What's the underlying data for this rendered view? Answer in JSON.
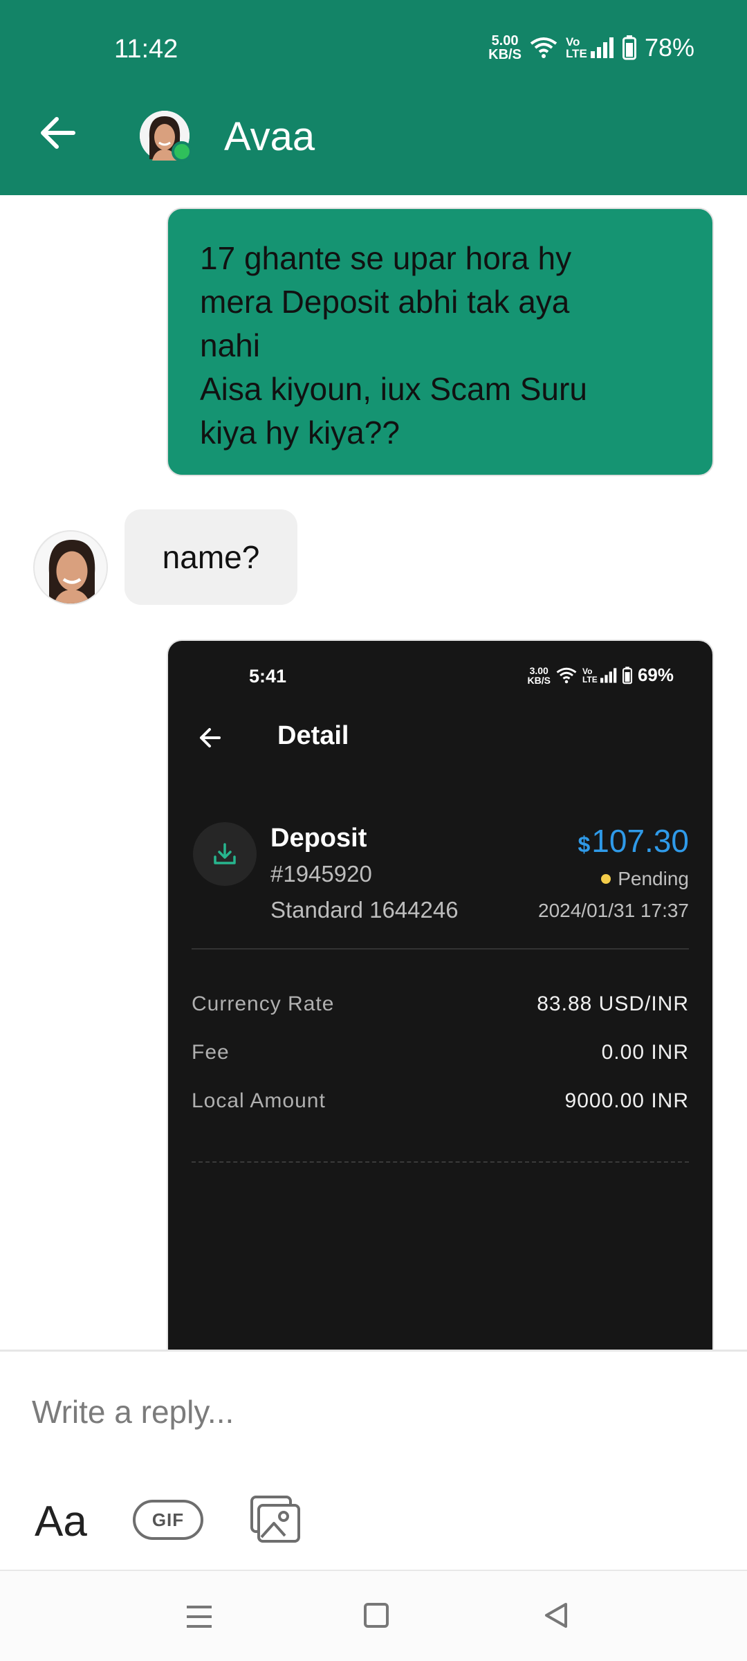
{
  "status_bar": {
    "time": "11:42",
    "speed_value": "5.00",
    "speed_unit": "KB/S",
    "volte": "Vo LTE",
    "battery": "78%"
  },
  "header": {
    "title": "Avaa",
    "background": "#138467",
    "online_color": "#2fc05b"
  },
  "messages": [
    {
      "from": "me",
      "lines": [
        "17 ghante se upar hora hy",
        "mera Deposit abhi tak aya",
        "nahi",
        "Aisa kiyoun, iux Scam Suru",
        "kiya hy kiya??"
      ]
    },
    {
      "from": "agent",
      "text": "name?"
    }
  ],
  "attachment": {
    "status_time": "5:41",
    "status_speed_value": "3.00",
    "status_speed_unit": "KB/S",
    "status_volte": "Vo LTE",
    "status_battery": "69%",
    "title": "Detail",
    "deposit_label": "Deposit",
    "deposit_id": "#1945920",
    "account": "Standard 1644246",
    "currency_symbol": "$",
    "amount": "107.30",
    "status": "Pending",
    "datetime": "2024/01/31 17:37",
    "rows": [
      {
        "label": "Currency Rate",
        "value": "83.88 USD/INR"
      },
      {
        "label": "Fee",
        "value": "0.00 INR"
      },
      {
        "label": "Local Amount",
        "value": "9000.00 INR"
      }
    ]
  },
  "composer": {
    "placeholder": "Write a reply...",
    "text_format_label": "Aa",
    "gif_label": "GIF"
  },
  "icons": {
    "back": "arrow-left-icon",
    "image": "image-gallery-icon",
    "deposit": "download-tray-icon",
    "nav_menu": "menu-icon",
    "nav_home": "home-square-icon",
    "nav_back": "triangle-back-icon"
  }
}
